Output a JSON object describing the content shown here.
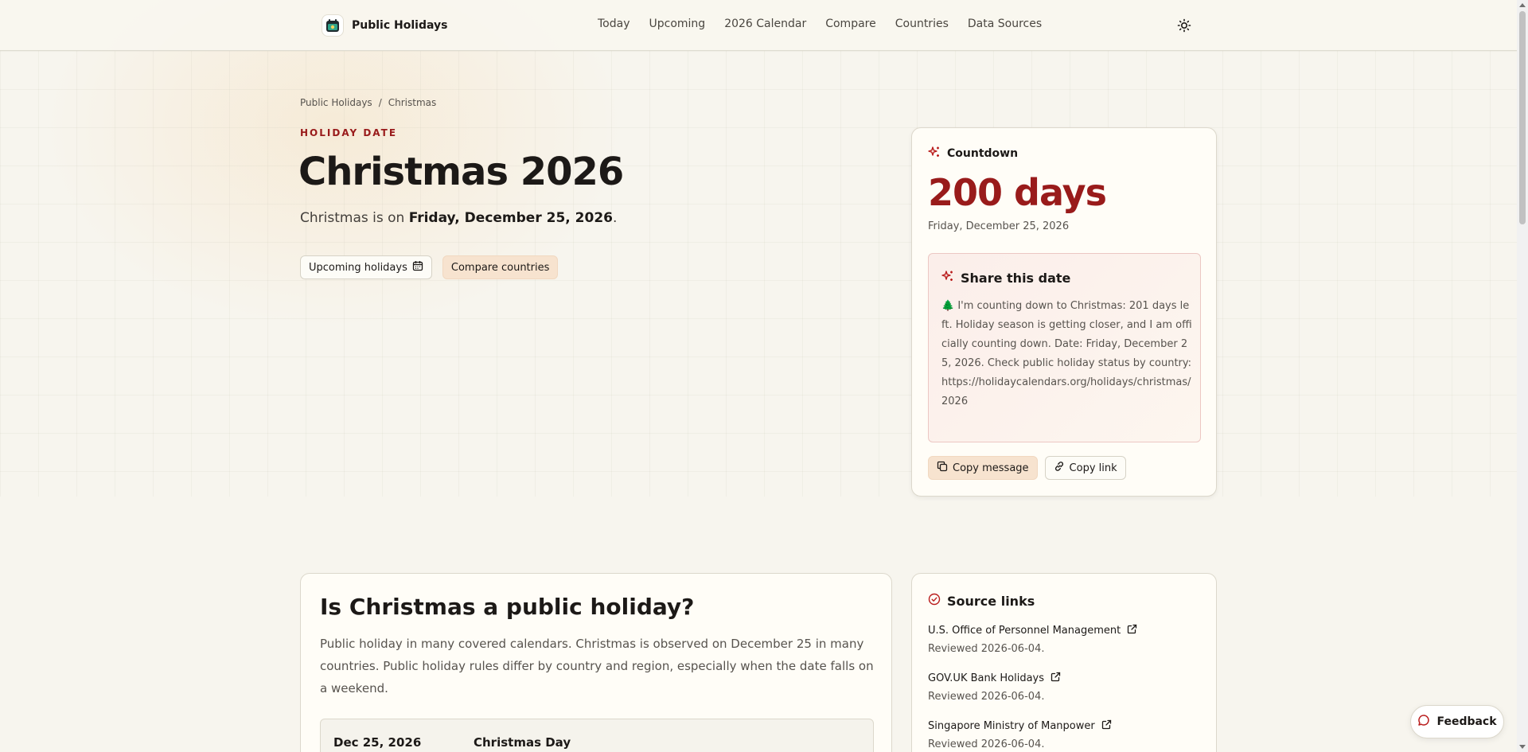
{
  "header": {
    "brand": "Public Holidays",
    "nav": [
      "Today",
      "Upcoming",
      "2026 Calendar",
      "Compare",
      "Countries",
      "Data Sources"
    ]
  },
  "breadcrumb": {
    "home": "Public Holidays",
    "separator": "/",
    "current": "Christmas"
  },
  "hero": {
    "eyebrow": "HOLIDAY DATE",
    "title": "Christmas 2026",
    "subtitle_prefix": "Christmas is on ",
    "subtitle_date": "Friday, December 25, 2026",
    "subtitle_suffix": ".",
    "upcoming_button": "Upcoming holidays",
    "compare_button": "Compare countries"
  },
  "countdown": {
    "heading": "Countdown",
    "days": "200 days",
    "date": "Friday, December 25, 2026",
    "share_heading": "Share this date",
    "share_message": "🌲 I'm counting down to Christmas: 201 days left. Holiday season is getting closer, and I am officially counting down. Date: Friday, December 25, 2026. Check public holiday status by country: https://holidaycalendars.org/holidays/christmas/2026",
    "copy_message": "Copy message",
    "copy_link": "Copy link"
  },
  "info": {
    "title": "Is Christmas a public holiday?",
    "text": "Public holiday in many covered calendars. Christmas is observed on December 25 in many countries. Public holiday rules differ by country and region, especially when the date falls on a weekend.",
    "row": {
      "date": "Dec 25, 2026",
      "name": "Christmas Day"
    }
  },
  "sources": {
    "heading": "Source links",
    "items": [
      {
        "name": "U.S. Office of Personnel Management",
        "reviewed": "Reviewed 2026-06-04."
      },
      {
        "name": "GOV.UK Bank Holidays",
        "reviewed": "Reviewed 2026-06-04."
      },
      {
        "name": "Singapore Ministry of Manpower",
        "reviewed": "Reviewed 2026-06-04."
      }
    ]
  },
  "feedback": {
    "label": "Feedback"
  },
  "colors": {
    "accent": "#991b1b",
    "tint": "#f7e3cf",
    "background": "#f7f5ee"
  }
}
